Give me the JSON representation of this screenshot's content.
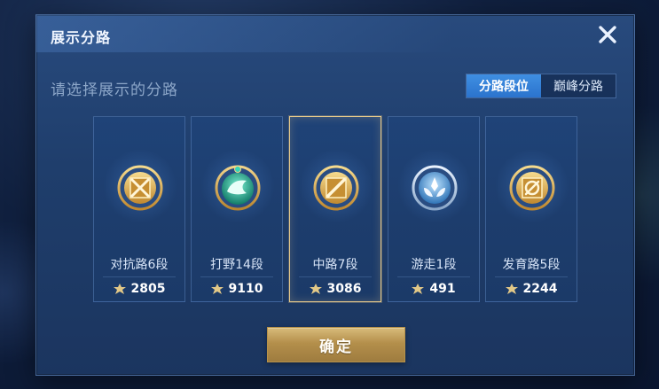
{
  "dialog": {
    "title": "展示分路",
    "subtitle": "请选择展示的分路",
    "tabs": [
      {
        "label": "分路段位",
        "active": true
      },
      {
        "label": "巅峰分路",
        "active": false
      }
    ],
    "confirm_label": "确定"
  },
  "lanes": [
    {
      "label": "对抗路6段",
      "points": "2805",
      "icon": "crossed-swords-emblem-icon",
      "selected": false
    },
    {
      "label": "打野14段",
      "points": "9110",
      "icon": "dragon-emblem-icon",
      "selected": false
    },
    {
      "label": "中路7段",
      "points": "3086",
      "icon": "mid-lane-emblem-icon",
      "selected": true
    },
    {
      "label": "游走1段",
      "points": "491",
      "icon": "wings-emblem-icon",
      "selected": false
    },
    {
      "label": "发育路5段",
      "points": "2244",
      "icon": "target-emblem-icon",
      "selected": false
    }
  ],
  "colors": {
    "gold": "#e6c98a",
    "active_tab": "#3f8fe2",
    "panel": "#1f3e6c"
  }
}
